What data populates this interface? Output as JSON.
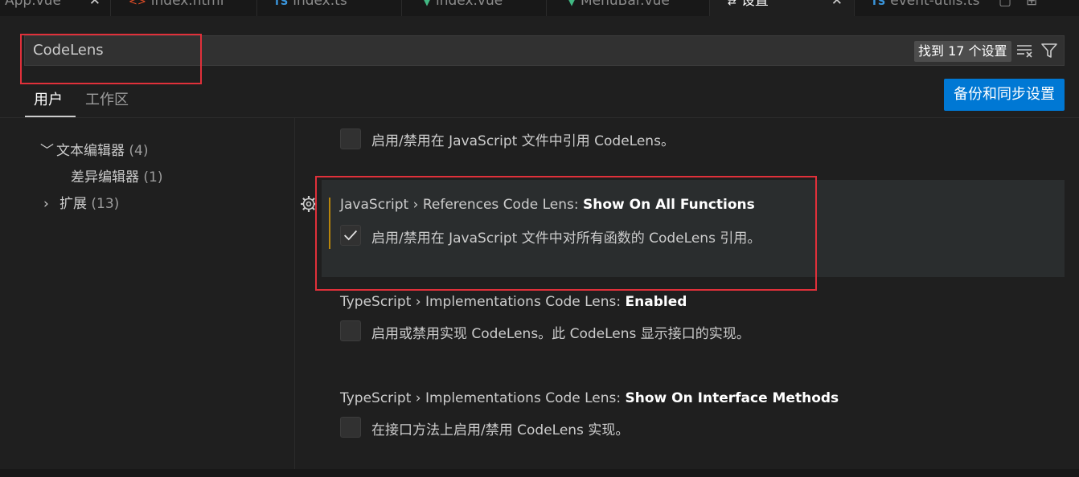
{
  "tabs": [
    {
      "label": "App.vue",
      "icon": "vue-icon",
      "closable": true
    },
    {
      "label": "index.html",
      "icon": "html-icon"
    },
    {
      "label": "index.ts",
      "icon": "ts-icon",
      "icon_text": "TS"
    },
    {
      "label": "index.vue",
      "icon": "vue-icon"
    },
    {
      "label": "MenuBar.vue",
      "icon": "vue-icon"
    },
    {
      "label": "设置",
      "icon": "settings-icon",
      "active": true,
      "closable": true
    },
    {
      "label": "event-utils.ts",
      "icon": "ts-icon",
      "icon_text": "TS"
    }
  ],
  "search": {
    "value": "CodeLens",
    "result_count": "找到 17 个设置"
  },
  "scope_tabs": [
    {
      "label": "用户",
      "active": true
    },
    {
      "label": "工作区",
      "active": false
    }
  ],
  "sync_button": "备份和同步设置",
  "tree": [
    {
      "label": "文本编辑器",
      "count": "(4)",
      "expanded": true
    },
    {
      "label": "差异编辑器",
      "count": "(1)"
    },
    {
      "label": "扩展",
      "count": "(13)",
      "expanded": false
    }
  ],
  "settings": [
    {
      "description": "启用/禁用在 JavaScript 文件中引用 CodeLens。",
      "checked": false
    },
    {
      "title_prefix": "JavaScript › References Code Lens: ",
      "title_name": "Show On All Functions",
      "description": "启用/禁用在 JavaScript 文件中对所有函数的 CodeLens 引用。",
      "checked": true
    },
    {
      "title_prefix": "TypeScript › Implementations Code Lens: ",
      "title_name": "Enabled",
      "description": "启用或禁用实现 CodeLens。此 CodeLens 显示接口的实现。",
      "checked": false
    },
    {
      "title_prefix": "TypeScript › Implementations Code Lens: ",
      "title_name": "Show On Interface Methods",
      "description": "在接口方法上启用/禁用 CodeLens 实现。",
      "checked": false
    }
  ],
  "colors": {
    "accent": "#0078d4",
    "annotation_red": "#e0303a",
    "modified_indicator": "#b8860b"
  }
}
